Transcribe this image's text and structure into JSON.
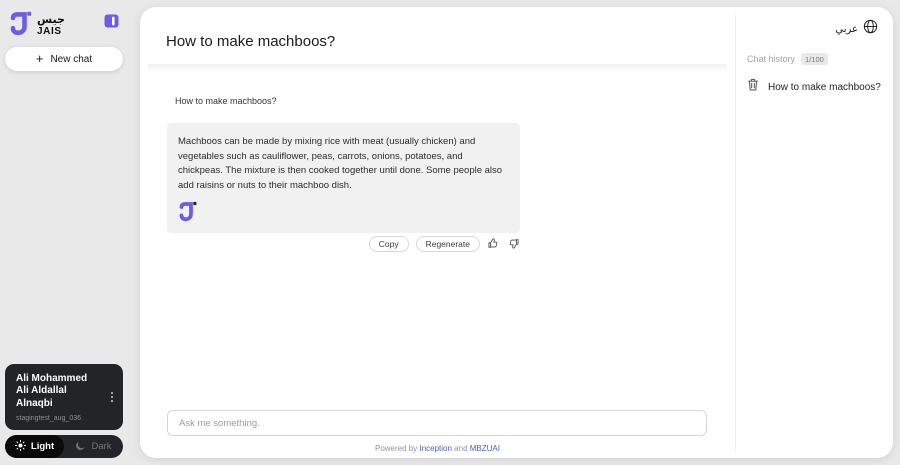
{
  "accent_color": "#6e5ce8",
  "link_color": "#4a5fc8",
  "sidebar": {
    "logo": {
      "arabic": "جيس",
      "latin": "JAIS"
    },
    "new_chat_label": "New chat",
    "user": {
      "name": "Ali Mohammed Ali Aldallal Alnaqbi",
      "username": "stagingtest_aug_036"
    },
    "theme_toggle": {
      "light_label": "Light",
      "dark_label": "Dark",
      "active": "Light"
    }
  },
  "chat": {
    "title": "How to make machboos?",
    "user_message": "How to make machboos?",
    "bot_response": "Machboos can be made by mixing rice with meat (usually chicken) and vegetables such as cauliflower, peas, carrots, onions, potatoes, and chickpeas. The mixture is then cooked together until done. Some people also add raisins or nuts to their machboo dish.",
    "actions": {
      "copy_label": "Copy",
      "regenerate_label": "Regenerate"
    },
    "input_placeholder": "Ask me something.",
    "footer": {
      "prefix": "Powered by",
      "link1": "Inception",
      "conjunction": "and",
      "link2": "MBZUAI"
    }
  },
  "history_panel": {
    "language_label": "عربي",
    "header_label": "Chat history",
    "count_badge": "1/100",
    "items": [
      {
        "title": "How to make machboos?"
      }
    ]
  }
}
